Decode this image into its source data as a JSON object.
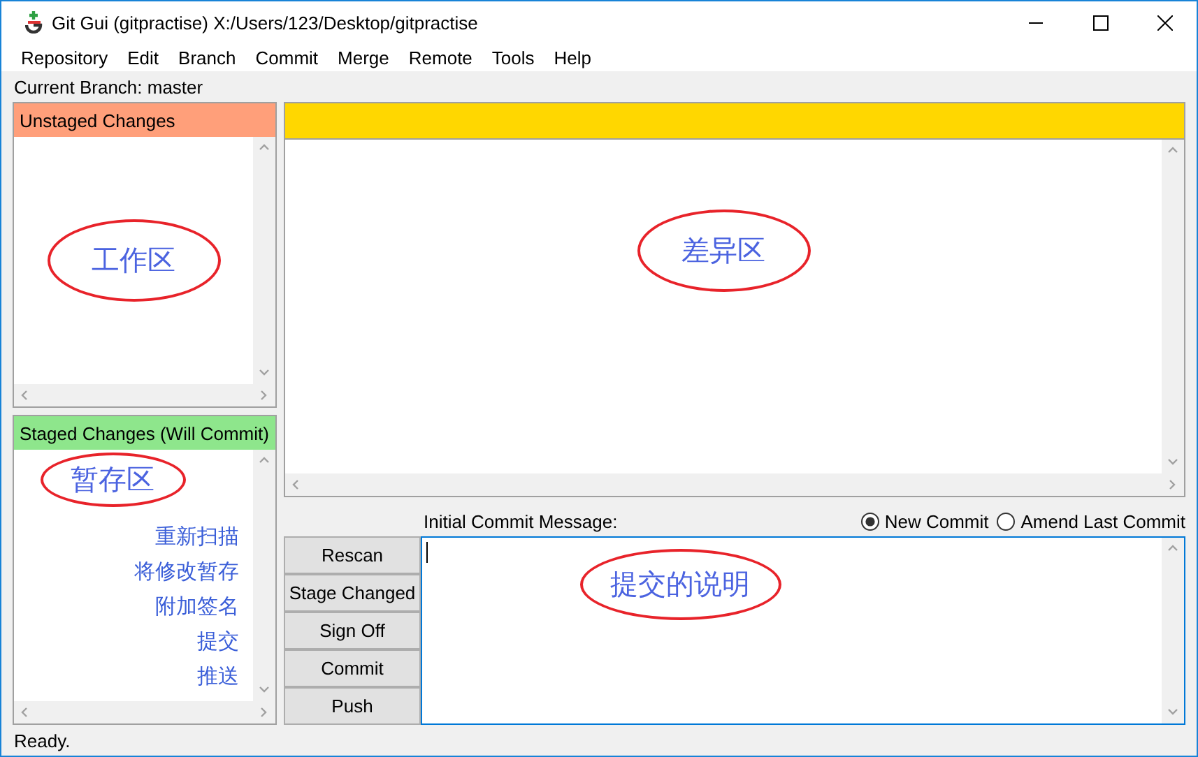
{
  "window": {
    "title": "Git Gui (gitpractise) X:/Users/123/Desktop/gitpractise"
  },
  "menu": [
    "Repository",
    "Edit",
    "Branch",
    "Commit",
    "Merge",
    "Remote",
    "Tools",
    "Help"
  ],
  "current_branch": "Current Branch: master",
  "unstaged_changes": {
    "title": "Unstaged Changes",
    "note": "工作区"
  },
  "staged_changes": {
    "title": "Staged Changes (Will Commit)",
    "note": "暂存区"
  },
  "button_notes": [
    "重新扫描",
    "将修改暂存",
    "附加签名",
    "提交",
    "推送"
  ],
  "diff": {
    "note": "差异区"
  },
  "commit": {
    "label": "Initial Commit Message:",
    "modes": [
      {
        "label": "New Commit",
        "selected": true
      },
      {
        "label": "Amend Last Commit",
        "selected": false
      }
    ],
    "buttons": [
      "Rescan",
      "Stage Changed",
      "Sign Off",
      "Commit",
      "Push"
    ],
    "note": "提交的说明"
  },
  "status_bar": "Ready."
}
